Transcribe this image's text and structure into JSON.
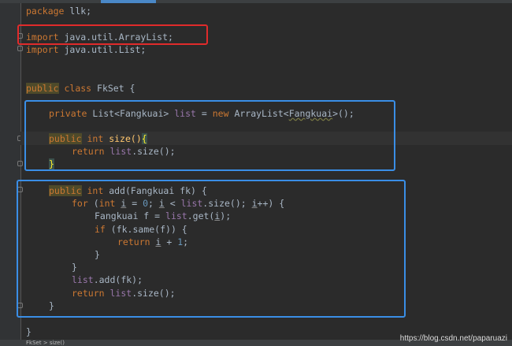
{
  "colors": {
    "background": "#2b2b2b",
    "keyword": "#cc7832",
    "field": "#9876aa",
    "method": "#ffc66d",
    "number": "#6897bb",
    "text": "#a9b7c6",
    "red_highlight": "#e02b2b",
    "blue_highlight": "#3a8ee6"
  },
  "icons": [
    "fold-marker-icon"
  ],
  "code": {
    "package_kw": "package",
    "package_rest": " llk;",
    "import1_kw": "import",
    "import1_rest": " java.util.ArrayList;",
    "import2_kw": "import",
    "import2_rest": " java.util.List;",
    "class_public": "public",
    "class_kw": " class",
    "class_rest": " FkSet {",
    "l6_private": "private",
    "l6_a": " List<Fangkuai> ",
    "l6_list": "list",
    "l6_b": " = ",
    "l6_new": "new",
    "l6_c": " ArrayList<",
    "l6_fk": "Fangkuai",
    "l6_d": ">();",
    "l8_public": "public",
    "l8_int": " int",
    "l8_sp": " ",
    "l8_size": "size",
    "l8_paren": "()",
    "l8_brace": "{",
    "l9_return": "return",
    "l9_sp": " ",
    "l9_list": "list",
    "l9_rest": ".size();",
    "l10_brace": "}",
    "l12_public": "public",
    "l12_int": " int",
    "l12_sp": " ",
    "l12_add": "add",
    "l12_rest": "(Fangkuai fk) {",
    "l13_for": "for",
    "l13_a": " (",
    "l13_int": "int",
    "l13_b": " ",
    "l13_i1": "i",
    "l13_c": " = ",
    "l13_zero": "0",
    "l13_d": "; ",
    "l13_i2": "i",
    "l13_e": " < ",
    "l13_list": "list",
    "l13_f": ".size(); ",
    "l13_i3": "i",
    "l13_g": "++) {",
    "l14_a": "Fangkuai f = ",
    "l14_list": "list",
    "l14_b": ".get(",
    "l14_i": "i",
    "l14_c": ");",
    "l15_if": "if",
    "l15_rest": " (fk.same(f)) {",
    "l16_return": "return",
    "l16_a": " ",
    "l16_i": "i",
    "l16_b": " + ",
    "l16_one": "1",
    "l16_c": ";",
    "l17_brace": "}",
    "l18_brace": "}",
    "l19_list": "list",
    "l19_rest": ".add(fk);",
    "l20_return": "return",
    "l20_sp": " ",
    "l20_list": "list",
    "l20_rest": ".size();",
    "l21_brace": "}",
    "l23_brace": "}"
  },
  "breadcrumb": "FkSet > size()",
  "watermark": "https://blog.csdn.net/paparuazi"
}
